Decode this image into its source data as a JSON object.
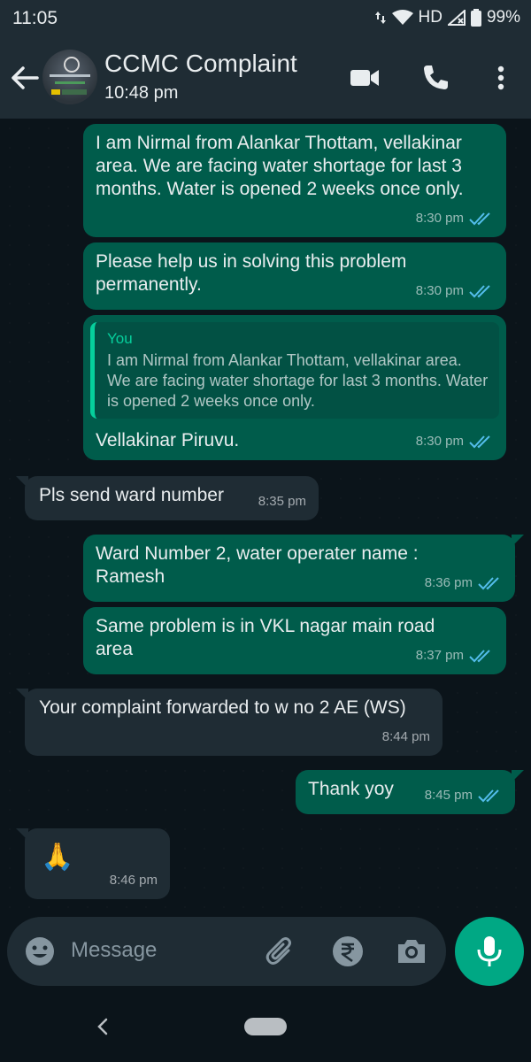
{
  "status_bar": {
    "time": "11:05",
    "network": "HD",
    "battery": "99%"
  },
  "header": {
    "title": "CCMC Complaint",
    "subtitle": "10:48 pm"
  },
  "messages": [
    {
      "text": "I am Nirmal from Alankar Thottam, vellakinar area. We are facing water shortage for last 3 months. Water is opened 2 weeks once only.",
      "time": "8:30 pm"
    },
    {
      "text": "Please help us in solving this problem permanently.",
      "time": "8:30 pm"
    },
    {
      "quote_name": "You",
      "quote_text": "I am Nirmal from Alankar Thottam, vellakinar area. We are facing water shortage for last 3 months. Water is opened 2 weeks once only.",
      "text": "Vellakinar Piruvu.",
      "time": "8:30 pm"
    },
    {
      "text": "Pls send ward number",
      "time": "8:35 pm"
    },
    {
      "text": "Ward Number 2, water operater name  : Ramesh",
      "time": "8:36 pm"
    },
    {
      "text": "Same problem is in VKL nagar main road area",
      "time": "8:37 pm"
    },
    {
      "text": "Your complaint forwarded to w no 2 AE (WS)",
      "time": "8:44 pm"
    },
    {
      "text": "Thank yoy",
      "time": "8:45 pm"
    },
    {
      "text": "🙏",
      "time": "8:46 pm"
    }
  ],
  "input": {
    "placeholder": "Message"
  },
  "colors": {
    "outgoing": "#005c4b",
    "incoming": "#1f2c34",
    "accent": "#00a884",
    "read_tick": "#53bdeb"
  },
  "icons": [
    "back-arrow-icon",
    "video-call-icon",
    "phone-icon",
    "more-vert-icon",
    "emoji-icon",
    "attach-icon",
    "rupee-icon",
    "camera-icon",
    "mic-icon"
  ]
}
